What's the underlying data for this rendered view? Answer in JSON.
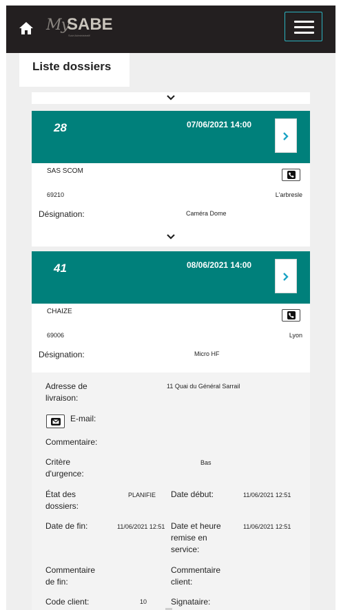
{
  "header": {
    "logo_my": "My",
    "logo_sabe": "SABE",
    "logo_tagline": "Suivi Administratif"
  },
  "page": {
    "title": "Liste dossiers"
  },
  "cards": [
    {
      "number": "28",
      "datetime": "07/06/2021 14:00",
      "client": "SAS SCOM",
      "zip": "69210",
      "city": "L'arbresle",
      "designation_label": "Désignation:",
      "designation_value": "Caméra Dome"
    },
    {
      "number": "41",
      "datetime": "08/06/2021 14:00",
      "client": "CHAIZE",
      "zip": "69006",
      "city": "Lyon",
      "designation_label": "Désignation:",
      "designation_value": "Micro HF"
    }
  ],
  "details": {
    "adresse_label": "Adresse de livraison:",
    "adresse_value": "11 Quai du Général Sarrail",
    "email_label": "E-mail:",
    "commentaire_label": "Commentaire:",
    "critere_label": "Critère d'urgence:",
    "critere_value": "Bas",
    "etat_label": "État des dossiers:",
    "etat_value": "PLANIFIE",
    "date_debut_label": "Date début:",
    "date_debut_value": "11/06/2021 12:51",
    "date_fin_label": "Date de fin:",
    "date_fin_value": "11/06/2021 12:51",
    "remise_label": "Date et heure remise en service:",
    "remise_value": "11/06/2021 12:51",
    "commentaire_fin_label": "Commentaire de fin:",
    "commentaire_client_label": "Commentaire client:",
    "code_client_label": "Code client:",
    "code_client_value": "10",
    "signataire_label": "Signataire:"
  },
  "icons": {
    "home": "home-icon",
    "menu": "hamburger-icon",
    "expand": "chevron-down-icon",
    "open": "chevron-right-icon",
    "phone": "phone-icon",
    "email": "envelope-icon"
  },
  "colors": {
    "topbar": "#231f20",
    "card_header": "#00807b",
    "accent": "#2bb3c0",
    "background": "#efefef"
  }
}
